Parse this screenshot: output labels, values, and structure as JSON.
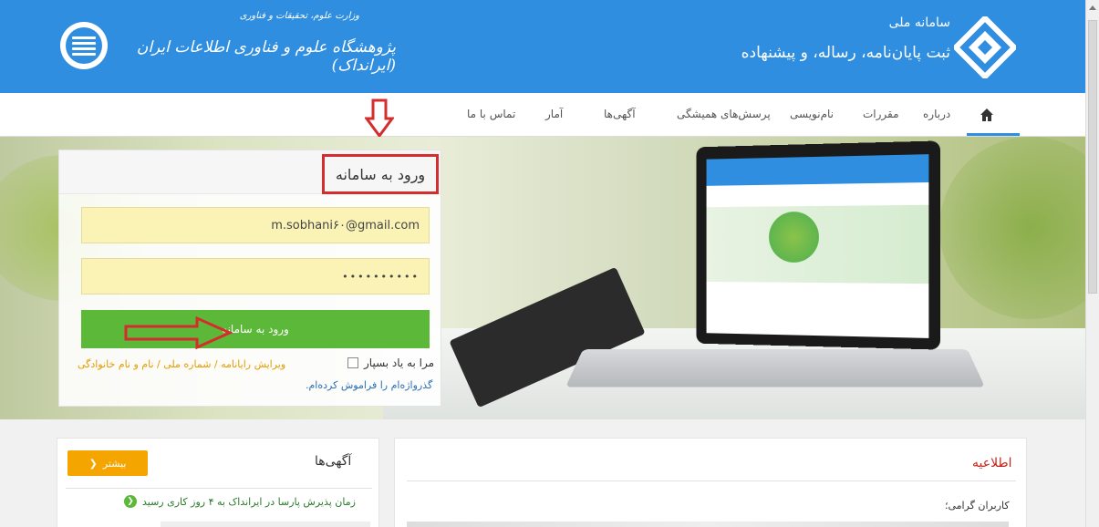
{
  "header": {
    "irandoc_subtitle": "وزارت علوم، تحقیقات و فناوری",
    "irandoc_title": "پژوهشگاه علوم و فناوری اطلاعات ایران (ایرانداک)",
    "system_small": "سامانه ملی",
    "system_title": "ثبت پایان‌نامه، رساله، و پیشنهاده"
  },
  "nav": {
    "items": [
      {
        "label": "درباره"
      },
      {
        "label": "مقررات"
      },
      {
        "label": "نام‌نویسی"
      },
      {
        "label": "پرسش‌های همیشگی"
      },
      {
        "label": "آگهی‌ها"
      },
      {
        "label": "آمار"
      },
      {
        "label": "تماس با ما"
      }
    ]
  },
  "login": {
    "title": "ورود به سامانه",
    "email_value": "m.sobhani۶۰@gmail.com",
    "password_value": "••••••••••",
    "submit_label": "ورود به سامانه",
    "remember_label": "مرا به یاد بسپار",
    "edit_link": "ویرایش رایانامه / شماره ملی / نام و نام خانوادگی",
    "forgot_link": "گذرواژه‌ام را فراموش کرده‌ام."
  },
  "notice": {
    "title": "اطلاعیه",
    "greeting": "کاربران گرامی؛"
  },
  "ads": {
    "title": "آگهی‌ها",
    "more_label": "بیشتر",
    "item1": "زمان پذیرش پارسا در ایرانداک به ۴ روز کاری رسید"
  },
  "colors": {
    "header_blue": "#2f8ee0",
    "login_green": "#5cb838",
    "annotation_red": "#d52d2d",
    "more_orange": "#f5a500"
  }
}
